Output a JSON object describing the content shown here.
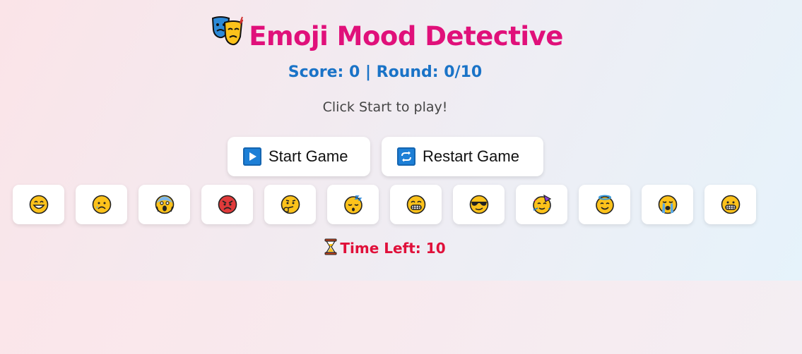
{
  "title": {
    "icon": "theater-masks-icon",
    "text": "Emoji Mood Detective"
  },
  "score_line": "Score: 0 | Round: 0/10",
  "status_text": "Click Start to play!",
  "buttons": {
    "start": {
      "icon": "play-button-icon",
      "label": "Start Game"
    },
    "restart": {
      "icon": "repeat-arrows-icon",
      "label": "Restart Game"
    }
  },
  "emoji_options": [
    {
      "mood": "happy",
      "icon": "grinning-face-icon"
    },
    {
      "mood": "sad",
      "icon": "sad-face-icon"
    },
    {
      "mood": "scared",
      "icon": "screaming-face-icon"
    },
    {
      "mood": "angry",
      "icon": "angry-face-icon"
    },
    {
      "mood": "confused",
      "icon": "confused-face-icon"
    },
    {
      "mood": "sleepy",
      "icon": "sleeping-face-icon"
    },
    {
      "mood": "excited",
      "icon": "beaming-face-icon"
    },
    {
      "mood": "cool",
      "icon": "sunglasses-face-icon"
    },
    {
      "mood": "party",
      "icon": "party-face-icon"
    },
    {
      "mood": "angelic",
      "icon": "halo-face-icon"
    },
    {
      "mood": "crying",
      "icon": "crying-face-icon"
    },
    {
      "mood": "nervous",
      "icon": "grimacing-face-icon"
    }
  ],
  "timer": {
    "icon": "hourglass-icon",
    "text": "Time Left: 10"
  },
  "colors": {
    "title": "#e0107a",
    "score": "#1a73c7",
    "timer": "#e0103a",
    "emoji_yellow": "#fcc21b"
  }
}
